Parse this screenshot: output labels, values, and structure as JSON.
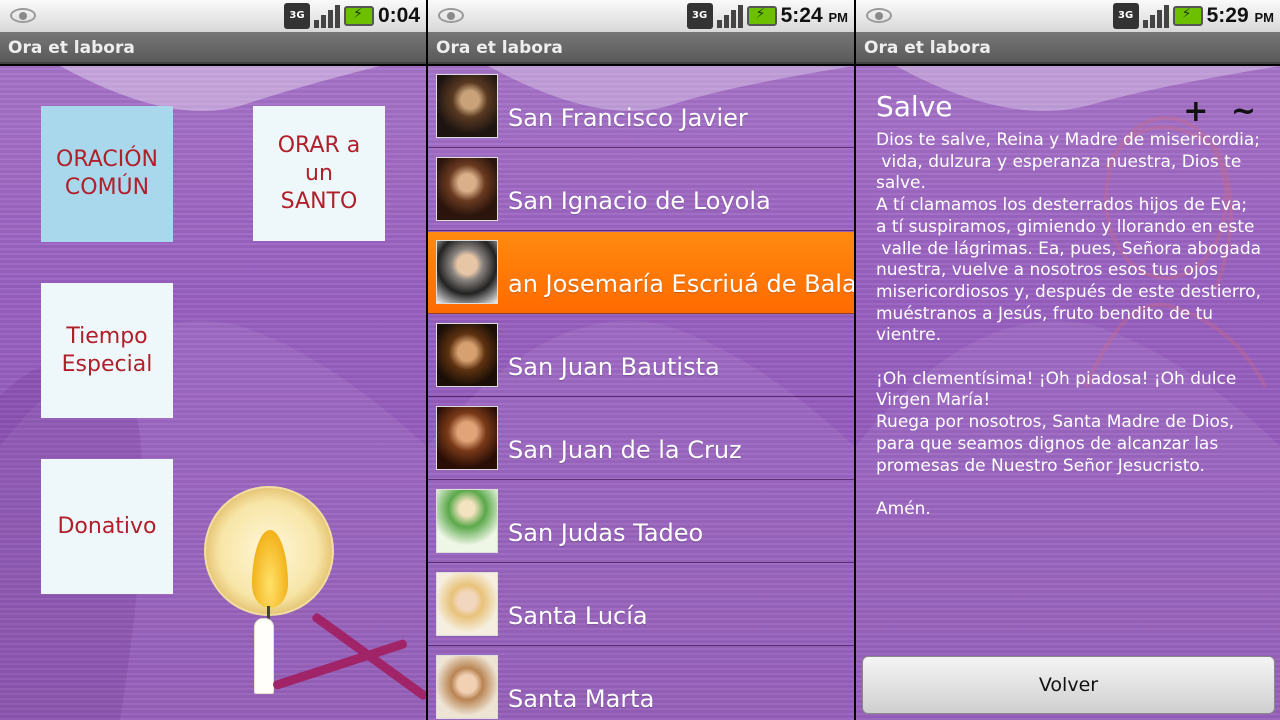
{
  "app_title": "Ora et labora",
  "status": [
    {
      "net": "3G",
      "time": "0:04",
      "ampm": ""
    },
    {
      "net": "3G",
      "time": "5:24",
      "ampm": "PM"
    },
    {
      "net": "3G",
      "time": "5:29",
      "ampm": "PM"
    }
  ],
  "menu": {
    "oracion_comun": "ORACIÓN\nCOMÚN",
    "orar_santo": "ORAR a\nun\nSANTO",
    "tiempo_especial": "Tiempo\nEspecial",
    "donativo": "Donativo"
  },
  "saints": [
    {
      "label": "San Francisco Javier",
      "selected": false
    },
    {
      "label": "San Ignacio de Loyola",
      "selected": false
    },
    {
      "label": "an Josemaría Escriuá de Balagu",
      "selected": true
    },
    {
      "label": "San Juan Bautista",
      "selected": false
    },
    {
      "label": "San Juan de la Cruz",
      "selected": false
    },
    {
      "label": "San Judas Tadeo",
      "selected": false
    },
    {
      "label": "Santa Lucía",
      "selected": false
    },
    {
      "label": "Santa Marta",
      "selected": false
    }
  ],
  "prayer": {
    "title": "Salve",
    "zoom_controls": "+ ~",
    "text": "Dios te salve, Reina y Madre de misericordia;\n vida, dulzura y esperanza nuestra, Dios te\nsalve.\nA tí clamamos los desterrados hijos de Eva;\na tí suspiramos, gimiendo y llorando en este\n valle de lágrimas. Ea, pues, Señora abogada\nnuestra, vuelve a nosotros esos tus ojos\nmisericordiosos y, después de este destierro,\nmuéstranos a Jesús, fruto bendito de tu\nvientre.\n\n¡Oh clementísima! ¡Oh piadosa! ¡Oh dulce\nVirgen María!\nRuega por nosotros, Santa Madre de Dios,\npara que seamos dignos de alcanzar las\npromesas de Nuestro Señor Jesucristo.\n\nAmén.",
    "back_button": "Volver"
  },
  "colors": {
    "purple": "#9860c0",
    "tile_text": "#b01f2a",
    "selected": "#ff7a00"
  }
}
